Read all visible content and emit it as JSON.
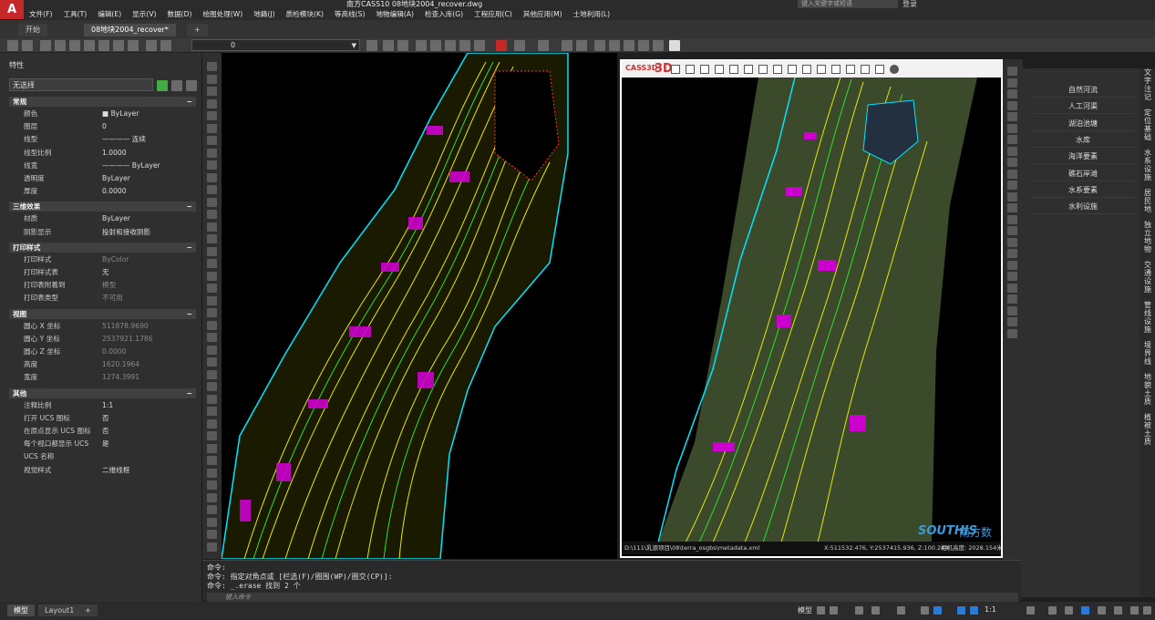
{
  "app": {
    "logo_letter": "A",
    "title": "南方CASS10    08地块2004_recover.dwg",
    "search_placeholder": "键入关键字或短语",
    "login_label": "登录"
  },
  "menu": [
    "文件(F)",
    "工具(T)",
    "编辑(E)",
    "显示(V)",
    "数据(D)",
    "绘图处理(W)",
    "地籍(J)",
    "质检模块(K)",
    "等高线(S)",
    "地物编辑(A)",
    "检查入库(G)",
    "工程应用(C)",
    "其他应用(M)",
    "土地利用(L)"
  ],
  "tabs": {
    "start": "开始",
    "doc": "08地块2004_recover*",
    "add": "+"
  },
  "layer": {
    "value": "0"
  },
  "properties": {
    "title": "特性",
    "selection": "无选择",
    "sections": [
      {
        "title": "常规",
        "rows": [
          {
            "label": "颜色",
            "value": "■ ByLayer"
          },
          {
            "label": "图层",
            "value": "0"
          },
          {
            "label": "线型",
            "value": "———— 连续"
          },
          {
            "label": "线型比例",
            "value": "1.0000"
          },
          {
            "label": "线宽",
            "value": "———— ByLayer"
          },
          {
            "label": "透明度",
            "value": "ByLayer"
          },
          {
            "label": "厚度",
            "value": "0.0000"
          }
        ]
      },
      {
        "title": "三维效果",
        "rows": [
          {
            "label": "材质",
            "value": "ByLayer"
          },
          {
            "label": "阴影显示",
            "value": "投射和接收阴影"
          }
        ]
      },
      {
        "title": "打印样式",
        "rows": [
          {
            "label": "打印样式",
            "value": "ByColor",
            "dim": true
          },
          {
            "label": "打印样式表",
            "value": "无"
          },
          {
            "label": "打印表附着到",
            "value": "模型",
            "dim": true
          },
          {
            "label": "打印表类型",
            "value": "不可用",
            "dim": true
          }
        ]
      },
      {
        "title": "视图",
        "rows": [
          {
            "label": "圆心 X 坐标",
            "value": "511878.9690",
            "dim": true
          },
          {
            "label": "圆心 Y 坐标",
            "value": "2537921.1786",
            "dim": true
          },
          {
            "label": "圆心 Z 坐标",
            "value": "0.0000",
            "dim": true
          },
          {
            "label": "高度",
            "value": "1620.1964",
            "dim": true
          },
          {
            "label": "宽度",
            "value": "1274.3991",
            "dim": true
          }
        ]
      },
      {
        "title": "其他",
        "rows": [
          {
            "label": "注释比例",
            "value": "1:1"
          },
          {
            "label": "打开 UCS 图标",
            "value": "否"
          },
          {
            "label": "在原点显示 UCS 图标",
            "value": "否"
          },
          {
            "label": "每个视口都显示 UCS",
            "value": "是"
          },
          {
            "label": "UCS 名称",
            "value": ""
          },
          {
            "label": "视觉样式",
            "value": "二维线框"
          }
        ]
      }
    ]
  },
  "cass3d": {
    "label": "CASS3D",
    "badge": "3D",
    "status_path": "D:\\111\\乳源项目\\08\\terra_osgbs\\metadata.xml",
    "status_coords": "X:511532.476, Y:2537415.936, Z:100.244",
    "status_height": "相机高度: 2028.154米",
    "brand": "SOUTHIS",
    "brand_cn": "南方数码"
  },
  "categories": [
    "自然河流",
    "人工河渠",
    "湖泊池塘",
    "水库",
    "海洋要素",
    "礁石岸滩",
    "水系要素",
    "水利设施"
  ],
  "vertical_tabs": [
    "文字注记",
    "定位基础",
    "水系设施",
    "居民地",
    "独立地物",
    "交通设施",
    "管线设施",
    "境界线",
    "地貌土质",
    "植被土质"
  ],
  "command": {
    "lines": [
      "命令:",
      "命令: 指定对角点或 [栏选(F)/圈围(WP)/圈交(CP)]:",
      "命令: _.erase 找到 2 个"
    ],
    "input_placeholder": "键入命令"
  },
  "status": {
    "model_tab": "模型",
    "layout_tab": "Layout1",
    "add": "+",
    "model_label": "模型",
    "scale": "1:1"
  }
}
